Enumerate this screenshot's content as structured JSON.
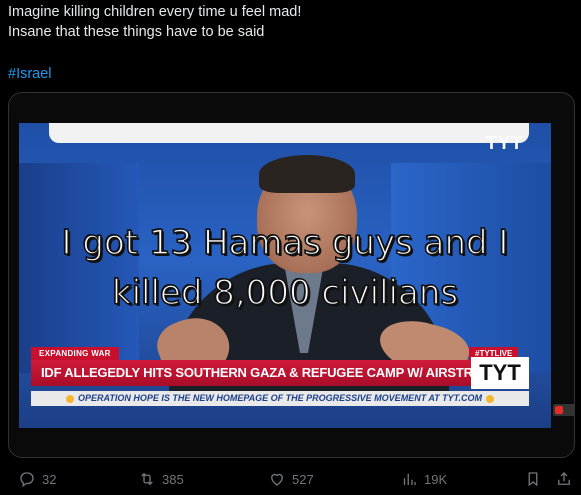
{
  "post": {
    "line1": "Imagine killing children every time u  feel mad!",
    "line2": "Insane that these things have to be said",
    "hashtag": "#Israel"
  },
  "video": {
    "watermark": "TYT",
    "caption_line1": "I got 13 Hamas guys and I",
    "caption_line2": "killed 8,000 civilians",
    "tag_left": "EXPANDING WAR",
    "tag_right": "#TYTLIVE",
    "headline": "IDF ALLEGEDLY HITS SOUTHERN GAZA & REFUGEE CAMP W/ AIRSTRIKES",
    "headline_logo": "TYT",
    "ticker": "OPERATION HOPE IS THE NEW HOMEPAGE OF THE PROGRESSIVE MOVEMENT AT TYT.COM"
  },
  "actions": {
    "replies": "32",
    "reposts": "385",
    "likes": "527",
    "views": "19K"
  },
  "icons": [
    "reply-icon",
    "repost-icon",
    "like-icon",
    "views-icon",
    "bookmark-icon",
    "share-icon"
  ],
  "colors": {
    "background": "#000000",
    "text": "#e7e9ea",
    "link": "#1d9bf0",
    "muted": "#71767b",
    "news_red": "#c8102e"
  }
}
